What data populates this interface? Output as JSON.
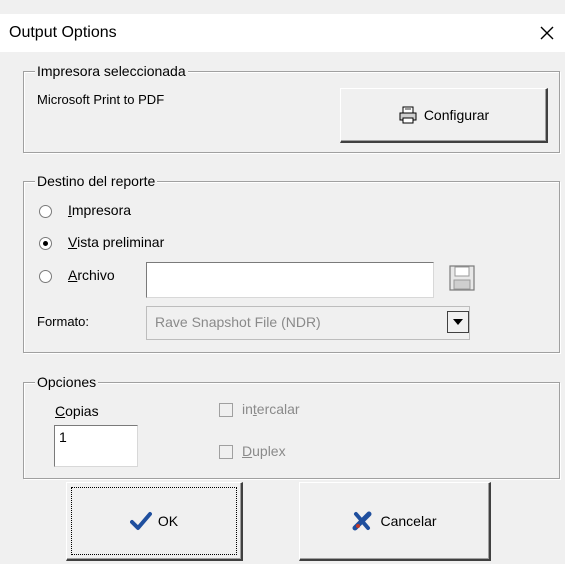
{
  "window": {
    "title": "Output Options",
    "close_glyph": "✕"
  },
  "printer_group": {
    "legend": "Impresora seleccionada",
    "printer_name": "Microsoft Print to PDF",
    "configure_label": "Configurar",
    "configure_icon": "printer-icon"
  },
  "destination_group": {
    "legend": "Destino del reporte",
    "options": [
      {
        "label_pre": "",
        "label_key": "I",
        "label_post": "mpresora",
        "selected": false
      },
      {
        "label_pre": "",
        "label_key": "V",
        "label_post": "ista preliminar",
        "selected": true
      },
      {
        "label_pre": "",
        "label_key": "A",
        "label_post": "rchivo",
        "selected": false
      }
    ],
    "file_value": "",
    "save_icon": "floppy-disk-icon",
    "format_label": "Formato:",
    "format_value": "Rave Snapshot File (NDR)"
  },
  "options_group": {
    "legend": "Opciones",
    "copies_label_key": "C",
    "copies_label_post": "opias",
    "copies_value": "1",
    "collate_pre": "in",
    "collate_key": "t",
    "collate_post": "ercalar",
    "collate_checked": false,
    "duplex_key": "D",
    "duplex_post": "uplex",
    "duplex_checked": false
  },
  "buttons": {
    "ok_label": "OK",
    "cancel_label": "Cancelar"
  },
  "colors": {
    "check_blue": "#1f4f9e",
    "cancel_blue": "#1f4f9e",
    "cancel_red": "#c0392b"
  }
}
